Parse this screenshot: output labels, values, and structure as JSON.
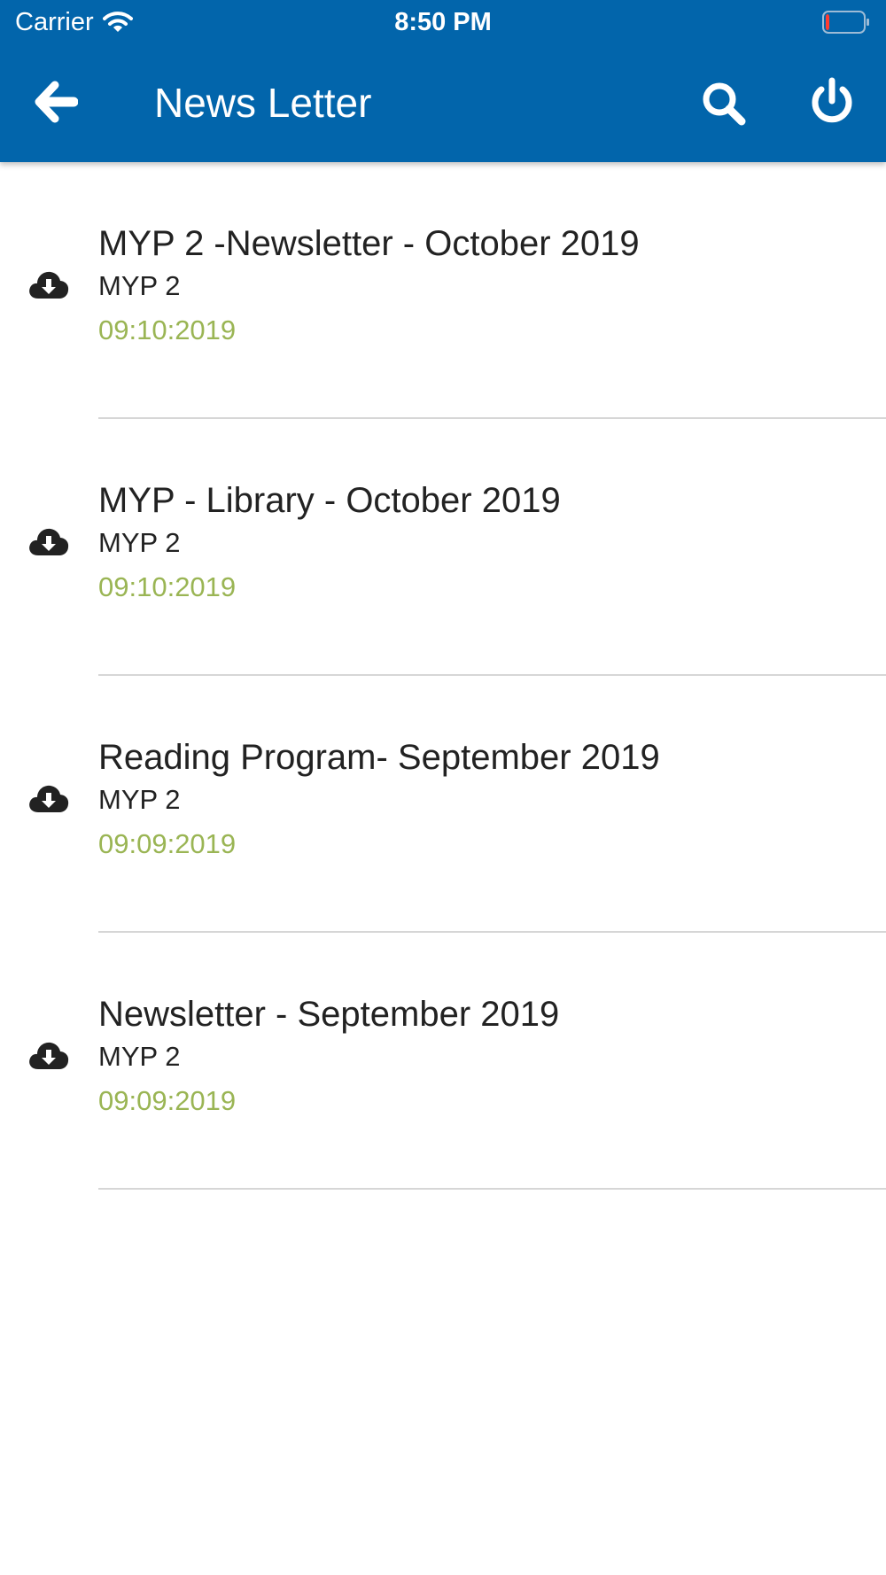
{
  "status_bar": {
    "carrier": "Carrier",
    "time": "8:50 PM",
    "battery_level": 0.08
  },
  "header": {
    "title": "News Letter",
    "back_icon": "arrow-left-icon",
    "search_icon": "search-icon",
    "power_icon": "power-icon",
    "background_color": "#0265ab"
  },
  "newsletters": [
    {
      "title": "MYP 2 -Newsletter - October 2019",
      "group": "MYP 2",
      "date": "09:10:2019"
    },
    {
      "title": "MYP - Library - October 2019",
      "group": "MYP 2",
      "date": "09:10:2019"
    },
    {
      "title": "Reading Program- September 2019",
      "group": "MYP 2",
      "date": "09:09:2019"
    },
    {
      "title": "Newsletter - September 2019",
      "group": "MYP 2",
      "date": "09:09:2019"
    }
  ],
  "colors": {
    "date_text": "#9ab554",
    "primary_text": "#222222",
    "divider": "#d6d6d6"
  }
}
